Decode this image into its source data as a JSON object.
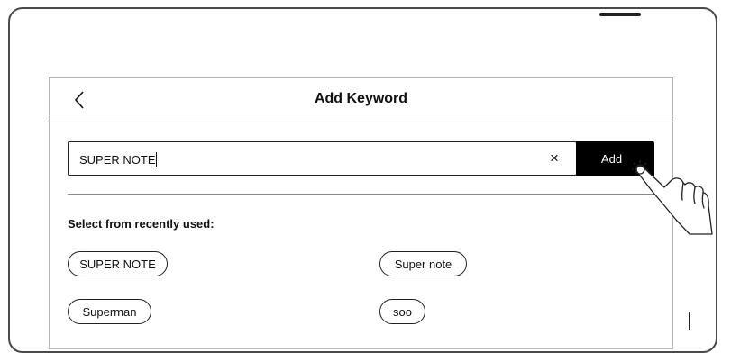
{
  "header": {
    "title": "Add Keyword",
    "back_icon": "chevron-left-icon"
  },
  "search": {
    "value": "SUPER NOTE",
    "clear_icon": "close-icon",
    "clear_glyph": "×",
    "add_label": "Add"
  },
  "recent": {
    "label": "Select from recently used:",
    "items": [
      {
        "label": "SUPER NOTE"
      },
      {
        "label": "Super note"
      },
      {
        "label": "Superman"
      },
      {
        "label": "soo"
      }
    ]
  },
  "colors": {
    "accent": "#000000",
    "border": "#222222",
    "background": "#ffffff"
  }
}
